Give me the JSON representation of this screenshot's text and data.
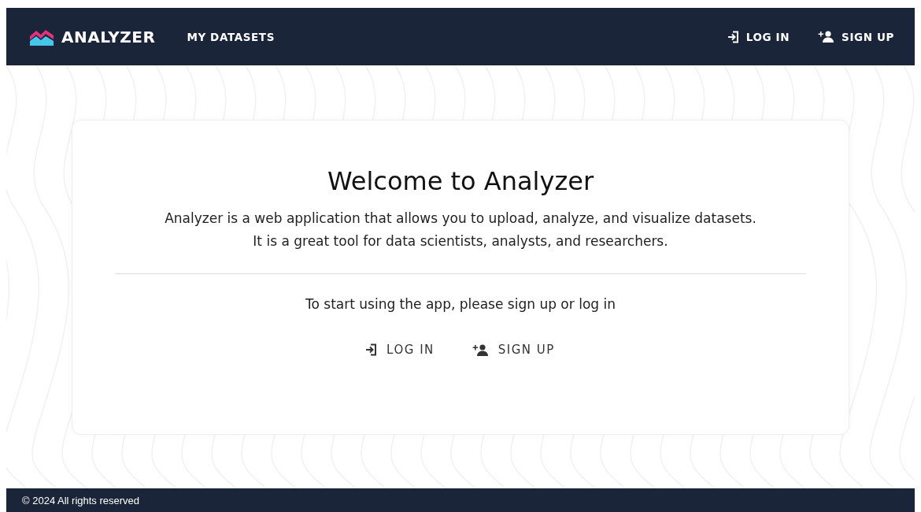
{
  "navbar": {
    "brand": "ANALYZER",
    "links": [
      {
        "label": "MY DATASETS"
      }
    ],
    "actions": [
      {
        "label": "LOG IN",
        "kind": "login"
      },
      {
        "label": "SIGN UP",
        "kind": "signup"
      }
    ]
  },
  "welcome": {
    "title": "Welcome to Analyzer",
    "description": [
      "Analyzer is a web application that allows you to upload, analyze, and visualize datasets.",
      "It is a great tool for data scientists, analysts, and researchers."
    ],
    "prompt": "To start using the app, please sign up or log in",
    "actions": [
      {
        "label": "LOG IN",
        "kind": "login"
      },
      {
        "label": "SIGN UP",
        "kind": "signup"
      }
    ]
  },
  "footer": {
    "text": "© 2024 All rights reserved"
  }
}
